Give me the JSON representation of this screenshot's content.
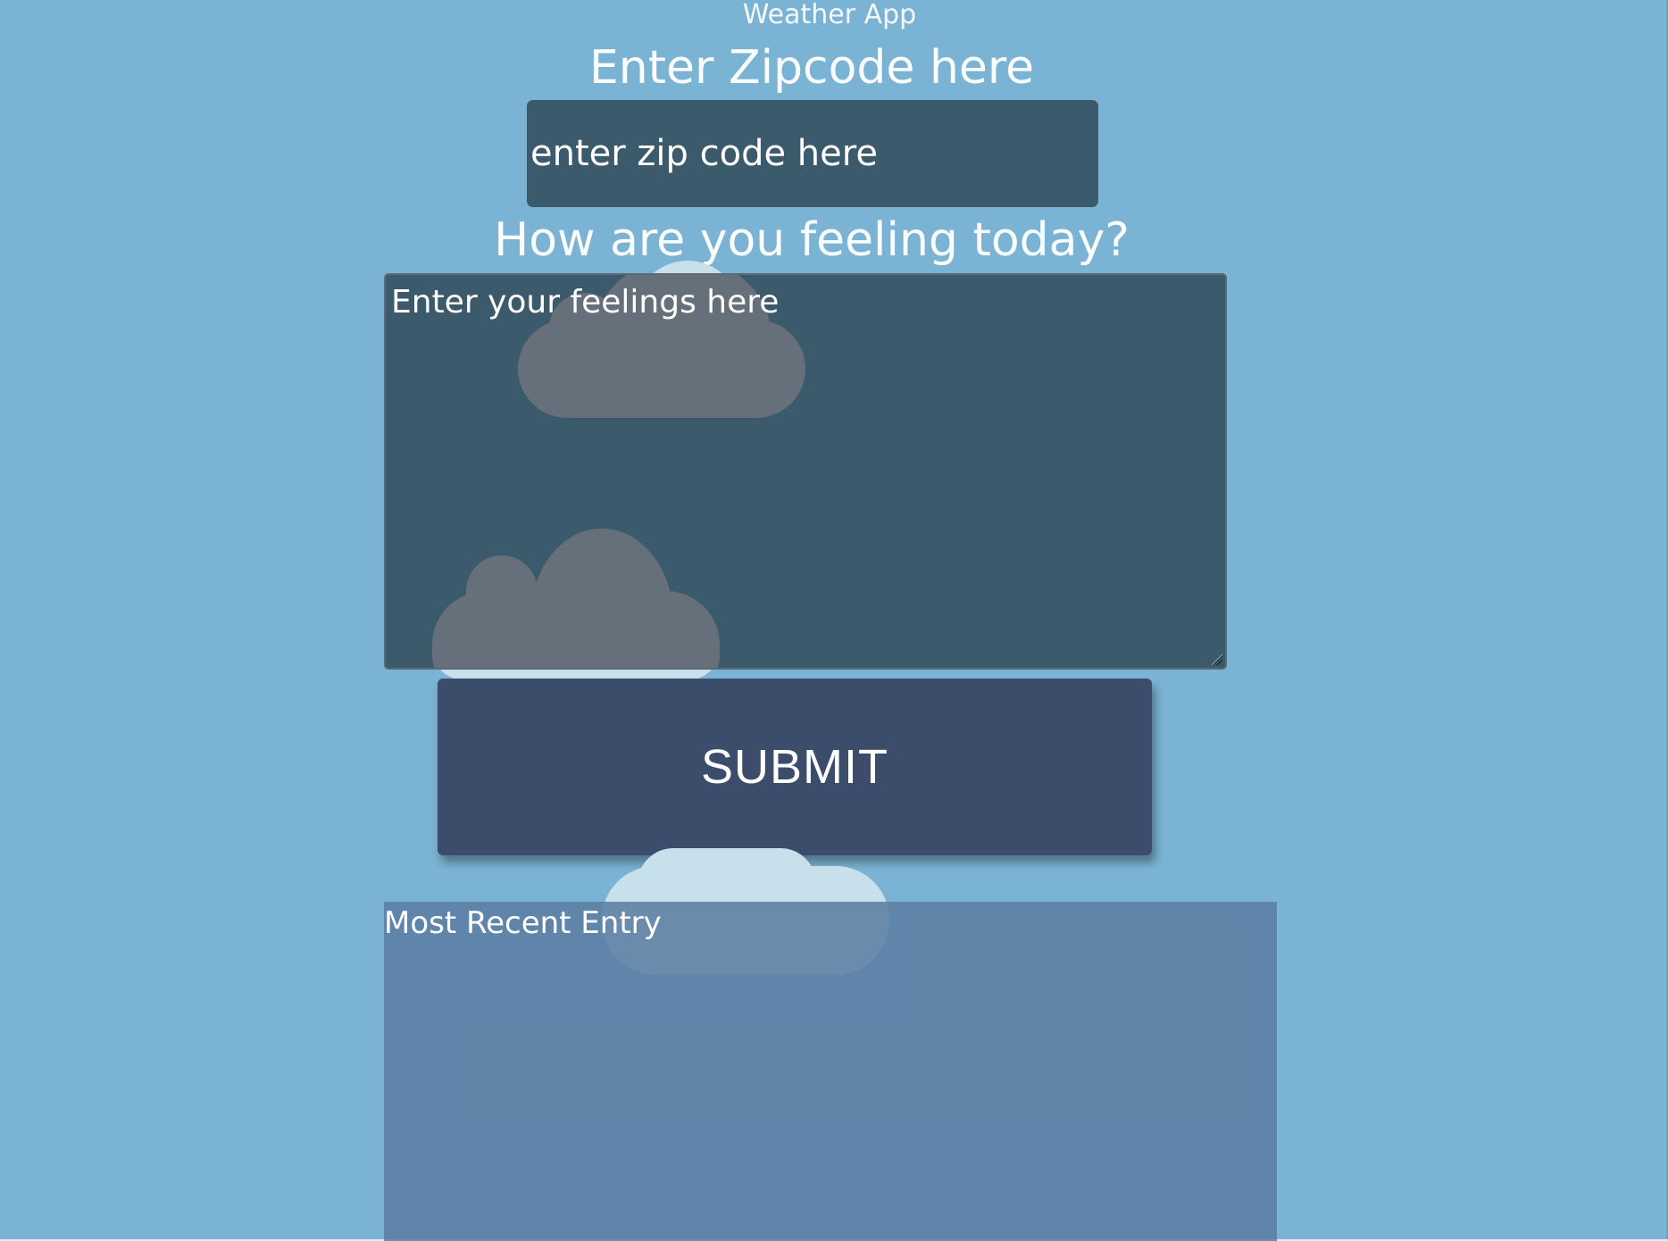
{
  "app": {
    "title": "Weather App"
  },
  "zip_section": {
    "heading": "Enter Zipcode here",
    "input_placeholder": "enter zip code here",
    "input_value": ""
  },
  "feelings_section": {
    "heading": "How are you feeling today?",
    "input_placeholder": "Enter your feelings here",
    "input_value": ""
  },
  "actions": {
    "submit_label": "SUBMIT"
  },
  "recent_entry": {
    "title": "Most Recent Entry"
  },
  "colors": {
    "background": "#7ab3d3",
    "input_background": "#3b5a6b",
    "button_background": "#3c4c6b",
    "entry_panel": "#5f88aa",
    "cloud_dark": "#66707a",
    "cloud_light": "#c8dfec"
  },
  "icons": {
    "decorations": [
      "cloud-icon",
      "cloud-icon",
      "cloud-icon"
    ],
    "textarea_grip": "resize-grip-icon"
  }
}
